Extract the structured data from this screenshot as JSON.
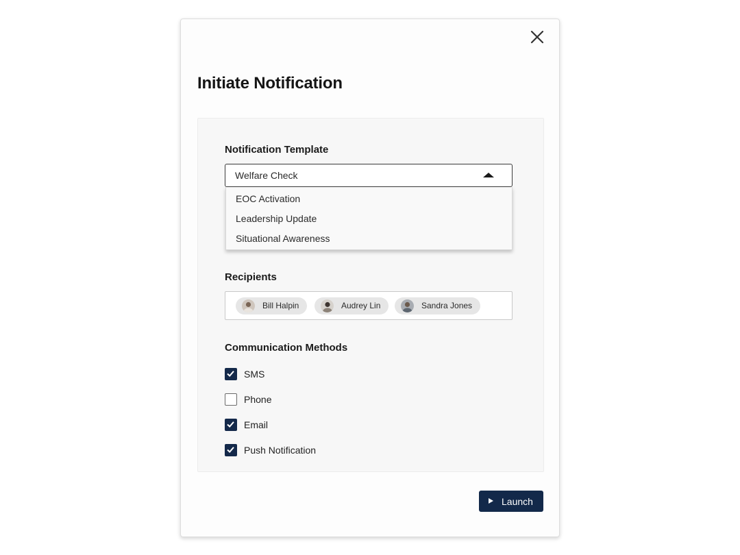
{
  "dialog": {
    "title": "Initiate Notification",
    "close_icon": "close-icon"
  },
  "template": {
    "label": "Notification Template",
    "selected": "Welfare Check",
    "options": [
      "EOC Activation",
      "Leadership Update",
      "Situational Awareness"
    ]
  },
  "recipients": {
    "label": "Recipients",
    "chips": [
      {
        "name": "Bill Halpin",
        "avatar": "avatar-photo"
      },
      {
        "name": "Audrey Lin",
        "avatar": "avatar-photo"
      },
      {
        "name": "Sandra Jones",
        "avatar": "avatar-photo"
      }
    ]
  },
  "methods": {
    "label": "Communication Methods",
    "items": [
      {
        "label": "SMS",
        "checked": true
      },
      {
        "label": "Phone",
        "checked": false
      },
      {
        "label": "Email",
        "checked": true
      },
      {
        "label": "Push Notification",
        "checked": true
      }
    ]
  },
  "actions": {
    "launch_label": "Launch",
    "launch_icon": "play-icon"
  },
  "colors": {
    "primary": "#13294a",
    "panel_bg": "#f7f7f7",
    "chip_bg": "#e6e6e6"
  }
}
